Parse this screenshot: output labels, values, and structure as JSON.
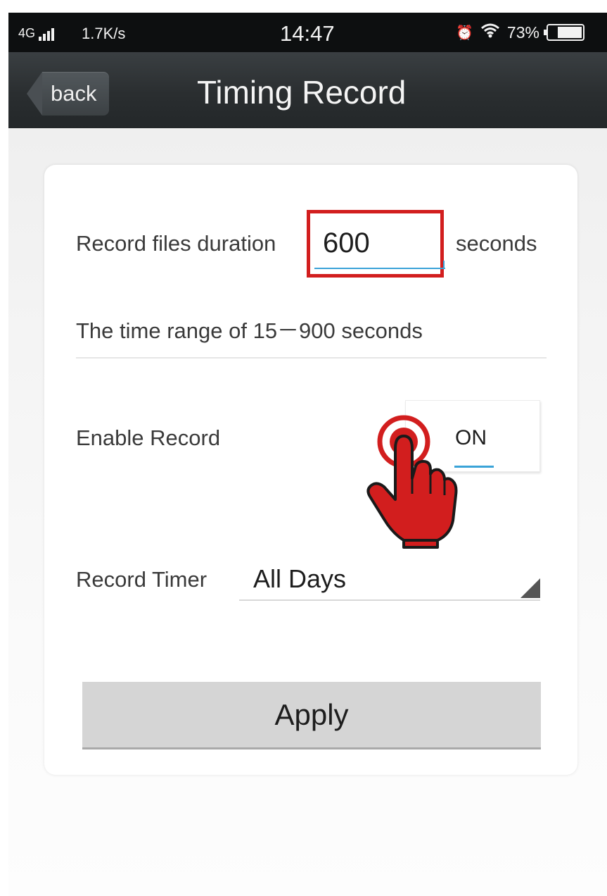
{
  "status_bar": {
    "network": "4G",
    "speed": "1.7K/s",
    "time": "14:47",
    "alarm_glyph": "⏰",
    "wifi_glyph": "📶",
    "battery": "73%"
  },
  "nav": {
    "back_label": "back",
    "title": "Timing Record"
  },
  "duration": {
    "label": "Record files duration",
    "value": "600",
    "unit": "seconds",
    "range_hint": "The time range of 15－900 seconds"
  },
  "enable_record": {
    "label": "Enable Record",
    "state": "ON"
  },
  "record_timer": {
    "label": "Record Timer",
    "selected": "All Days"
  },
  "apply_label": "Apply",
  "colors": {
    "highlight_red": "#d21e1e",
    "accent_blue": "#3aa3d8",
    "nav_bg": "#2a2e30"
  },
  "icons": {
    "tap_indicator": "tap-hand-icon",
    "dropdown": "triangle-corner-icon"
  }
}
